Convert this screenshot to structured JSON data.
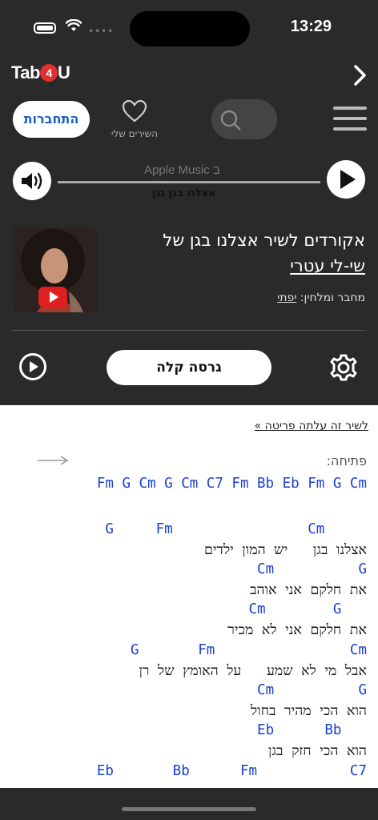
{
  "status_bar": {
    "time": "13:29"
  },
  "header": {
    "logo_text_a": "Tab",
    "logo_text_b": "4",
    "logo_text_c": "U",
    "login_label": "התחברות",
    "my_songs_label": "השירים שלי"
  },
  "player": {
    "source_label": "Apple Music ב",
    "song_label": "אצלנו בגן נגן"
  },
  "song": {
    "title": "אקורדים לשיר אצלנו בגן של",
    "artist": "שי-לי עטרי",
    "composer_prefix": "מחבר ומלחין:",
    "composer_name": "יפתי"
  },
  "controls": {
    "easy_version_label": "גרסה קלה"
  },
  "sheet": {
    "tutorial_link": "לשיר זה עלתה פריטה »",
    "intro_label": "פתיחה:",
    "lines": [
      {
        "type": "chord",
        "text": "Fm G Cm G Cm C7 Fm Bb Eb Fm G Cm"
      },
      {
        "type": "chord",
        "text": "G     Fm                Cm     "
      },
      {
        "type": "lyric",
        "text": "אצלנו בגן   יש המון ילדים"
      },
      {
        "type": "chord",
        "text": "Cm          G"
      },
      {
        "type": "lyric",
        "text": "את חלקם אני אוהב"
      },
      {
        "type": "chord",
        "text": "Cm        G   "
      },
      {
        "type": "lyric",
        "text": "את חלקם אני לא מכיר"
      },
      {
        "type": "chord",
        "text": "G       Fm                Cm"
      },
      {
        "type": "lyric",
        "text": "אבל מי לא שמע   על האומץ של רן"
      },
      {
        "type": "chord",
        "text": "Cm          G"
      },
      {
        "type": "lyric",
        "text": "הוא הכי מהיר בחול"
      },
      {
        "type": "chord",
        "text": "Eb      Bb   "
      },
      {
        "type": "lyric",
        "text": "הוא הכי חזק בגן"
      },
      {
        "type": "chord",
        "text": "Eb       Bb      Fm           C7"
      }
    ]
  },
  "colors": {
    "background": "#2a2a2a",
    "accent_blue": "#1a60c0",
    "chord_blue": "#1a40d0",
    "youtube_red": "#e02020"
  }
}
